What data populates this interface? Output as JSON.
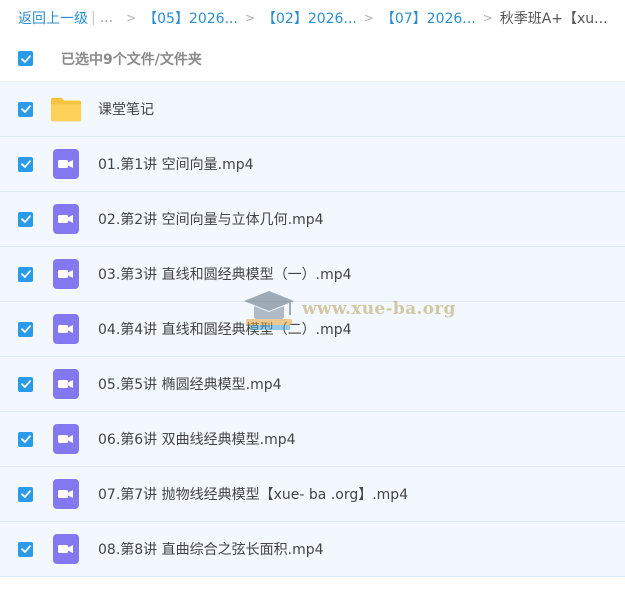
{
  "breadcrumb": {
    "back": "返回上一级",
    "ellipsis": "...",
    "crumbs": [
      "【05】2026...",
      "【02】2026...",
      "【07】2026..."
    ],
    "current": "秋季班A+【xu..."
  },
  "selection": {
    "summary": "已选中9个文件/文件夹"
  },
  "files": [
    {
      "name": "课堂笔记",
      "type": "folder"
    },
    {
      "name": "01.第1讲 空间向量.mp4",
      "type": "video"
    },
    {
      "name": "02.第2讲 空间向量与立体几何.mp4",
      "type": "video"
    },
    {
      "name": "03.第3讲 直线和圆经典模型（一）.mp4",
      "type": "video"
    },
    {
      "name": "04.第4讲 直线和圆经典模型（二）.mp4",
      "type": "video"
    },
    {
      "name": "05.第5讲 椭圆经典模型.mp4",
      "type": "video"
    },
    {
      "name": "06.第6讲 双曲线经典模型.mp4",
      "type": "video"
    },
    {
      "name": "07.第7讲 抛物线经典模型【xue- ba .org】.mp4",
      "type": "video"
    },
    {
      "name": "08.第8讲 直曲综合之弦长面积.mp4",
      "type": "video"
    }
  ],
  "watermark": {
    "text": "www.xue-ba.org",
    "icon": "graduation-cap-icon"
  },
  "colors": {
    "link": "#2b8ed3",
    "checkbox": "#2a9be8",
    "row_bg": "#f2f8fe",
    "folder": "#fcd25a",
    "video": "#8478f0"
  }
}
